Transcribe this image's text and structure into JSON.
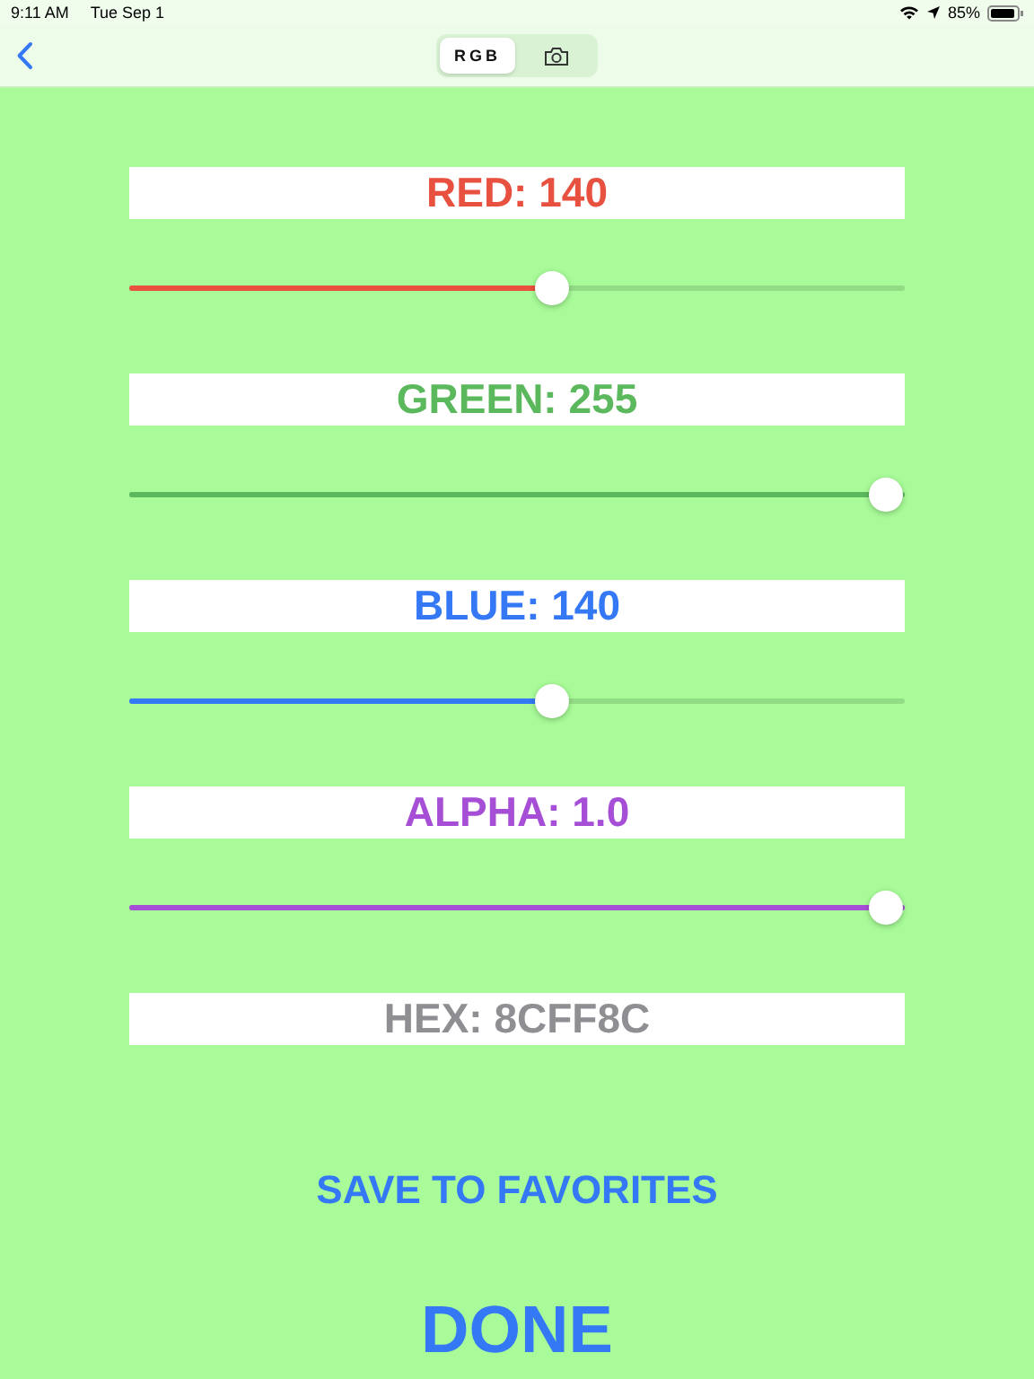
{
  "status_bar": {
    "time": "9:11 AM",
    "date": "Tue Sep 1",
    "battery": "85%"
  },
  "tabs": [
    {
      "kind": "text",
      "label": "RGB",
      "selected": true
    },
    {
      "kind": "camera",
      "selected": false
    }
  ],
  "channels": [
    {
      "kind": "slider",
      "label": "RED: 140",
      "color": "#e8503f",
      "level": 0.549
    },
    {
      "kind": "slider",
      "label": "GREEN: 255",
      "color": "#5cb85c",
      "level": 1
    },
    {
      "kind": "slider",
      "label": "BLUE: 140",
      "color": "#3478f6",
      "level": 0.549
    },
    {
      "kind": "slider",
      "label": "ALPHA: 1.0",
      "color": "#a64fd6",
      "level": 1
    },
    {
      "kind": "readout",
      "label": "HEX: 8CFF8C",
      "color": "#8e8e93"
    }
  ],
  "save_button": "SAVE TO FAVORITES",
  "done_button": "DONE"
}
